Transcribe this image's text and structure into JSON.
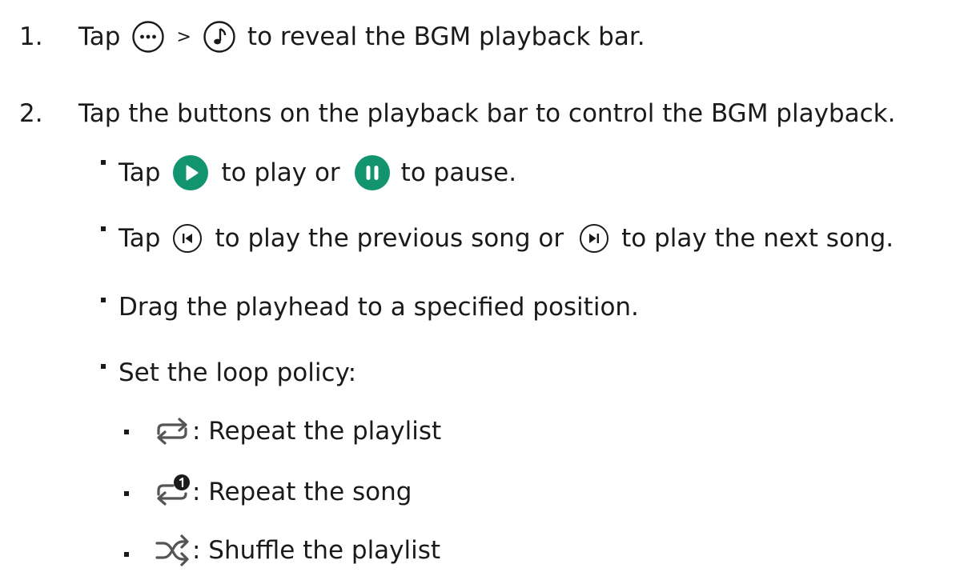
{
  "steps": [
    {
      "number": "1.",
      "tap": "Tap",
      "separator": ">",
      "text": "to reveal the BGM playback bar."
    },
    {
      "number": "2.",
      "text": "Tap the buttons on the playback bar to control the BGM playback."
    }
  ],
  "bullets": {
    "play_pause": {
      "tap": "Tap",
      "mid": "to play or",
      "end": "to pause."
    },
    "prev_next": {
      "tap": "Tap",
      "mid": "to play the previous song or",
      "end": "to play the next song."
    },
    "drag": "Drag the playhead to a specified position.",
    "loop": "Set the loop policy:"
  },
  "loop_options": [
    {
      "icon": "repeat-playlist-icon",
      "label": ": Repeat the playlist"
    },
    {
      "icon": "repeat-song-icon",
      "label": ": Repeat the song"
    },
    {
      "icon": "shuffle-icon",
      "label": ": Shuffle the playlist"
    }
  ],
  "colors": {
    "accent": "#12956f",
    "text": "#1a1a1a"
  }
}
